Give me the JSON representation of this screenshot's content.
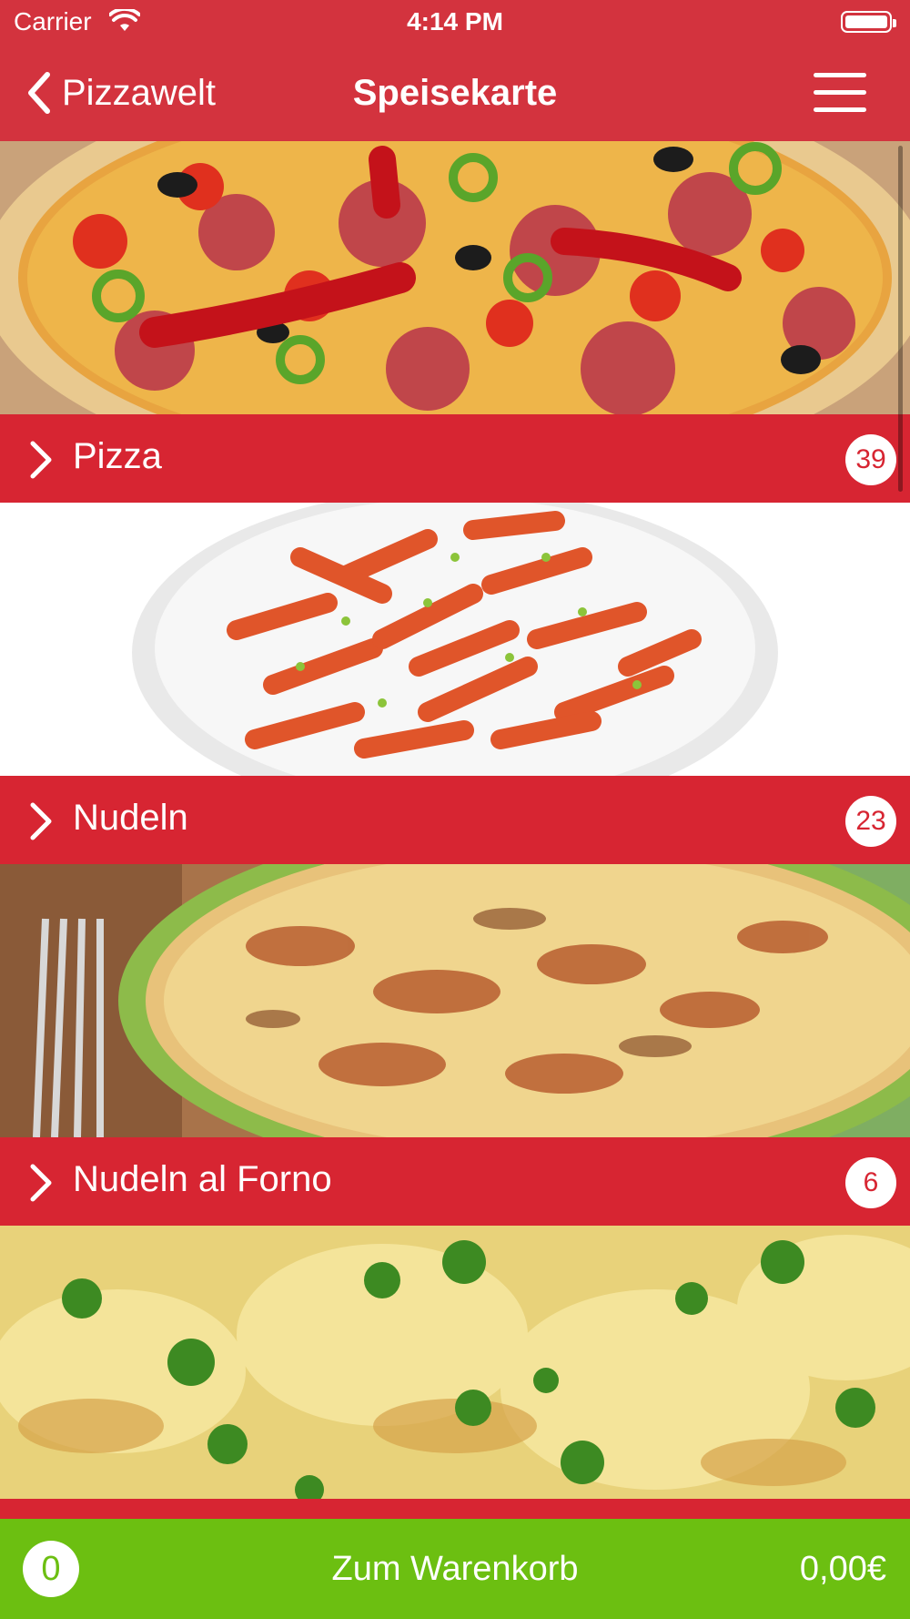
{
  "status_bar": {
    "carrier": "Carrier",
    "time": "4:14 PM",
    "wifi_icon": "wifi-icon",
    "battery_icon": "battery-icon"
  },
  "navbar": {
    "back_label": "Pizzawelt",
    "back_icon": "chevron-left-icon",
    "title": "Speisekarte",
    "menu_icon": "hamburger-menu-icon"
  },
  "categories": [
    {
      "name": "Pizza",
      "count": "39",
      "image": "pizza-photo"
    },
    {
      "name": "Nudeln",
      "count": "23",
      "image": "pasta-photo"
    },
    {
      "name": "Nudeln al Forno",
      "count": "6",
      "image": "baked-pasta-photo"
    },
    {
      "name": "",
      "count": "",
      "image": "gratin-photo"
    }
  ],
  "cart": {
    "count": "0",
    "label": "Zum Warenkorb",
    "total": "0,00€"
  },
  "colors": {
    "header_bg": "#d3333e",
    "category_bar": "#d72532",
    "cart_bar": "#6cbf11",
    "text_on_accent": "#ffffff"
  }
}
